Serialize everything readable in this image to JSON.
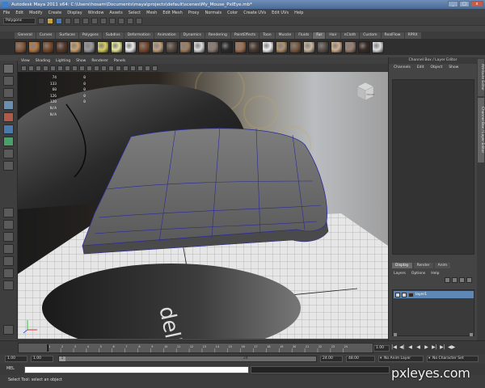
{
  "window": {
    "title": "Autodesk Maya 2011 x64: C:\\Users\\hosam\\Documents\\maya\\projects\\default\\scenes\\My_Mouse_PxlEye.mb*",
    "minimize": "_",
    "maximize": "□",
    "close": "x"
  },
  "menubar": [
    "File",
    "Edit",
    "Modify",
    "Create",
    "Display",
    "Window",
    "Assets",
    "Select",
    "Mesh",
    "Edit Mesh",
    "Proxy",
    "Normals",
    "Color",
    "Create UVs",
    "Edit UVs",
    "Help"
  ],
  "statusline": {
    "mode": "Polygons"
  },
  "shelf_tabs": [
    "General",
    "Curves",
    "Surfaces",
    "Polygons",
    "Subdivs",
    "Deformation",
    "Animation",
    "Dynamics",
    "Rendering",
    "PaintEffects",
    "Toon",
    "Muscle",
    "Fluids",
    "Fur",
    "Hair",
    "nCloth",
    "Custom",
    "RealFlow",
    "RPRX"
  ],
  "active_shelf": "Fur",
  "fur_swatches": [
    "#8a5a3a",
    "#b07a4a",
    "#7a4a2a",
    "#5a3a2a",
    "#caa070",
    "#9a9a9a",
    "#d8d060",
    "#e8e8a0",
    "#ececec",
    "#7a4a30",
    "#c0a080",
    "#5a4a40",
    "#a08060",
    "#dcdcdc",
    "#8a7a70",
    "#2a2a2a",
    "#a07050",
    "#4a3a30",
    "#f0f0f0",
    "#b09070",
    "#7a5a40",
    "#c8b8a0",
    "#5a5048",
    "#d0b090",
    "#9a8070",
    "#3a2a24",
    "#e0e0e0"
  ],
  "viewport_menu": [
    "View",
    "Shading",
    "Lighting",
    "Show",
    "Renderer",
    "Panels"
  ],
  "hud_stats": [
    {
      "a": "74",
      "b": "0"
    },
    {
      "a": "133",
      "b": "0"
    },
    {
      "a": "60",
      "b": "0"
    },
    {
      "a": "126",
      "b": "0"
    },
    {
      "a": "120",
      "b": "0"
    },
    {
      "a": "N/A",
      "b": ""
    },
    {
      "a": "N/A",
      "b": ""
    }
  ],
  "viewcube_label": "FRONT",
  "channel_box": {
    "title": "Channel Box / Layer Editor",
    "menu": [
      "Channels",
      "Edit",
      "Object",
      "Show"
    ]
  },
  "layer_editor": {
    "tabs": [
      "Display",
      "Render",
      "Anim"
    ],
    "active_tab": "Display",
    "menu": [
      "Layers",
      "Options",
      "Help"
    ],
    "layers": [
      {
        "v": "V",
        "p": "P",
        "name": "layer1"
      }
    ]
  },
  "side_tabs": [
    "Attribute Editor",
    "Channel Box / Layer Editor"
  ],
  "timeslider": {
    "ticks": [
      "1",
      "2",
      "3",
      "4",
      "5",
      "6",
      "7",
      "8",
      "9",
      "10",
      "11",
      "12",
      "13",
      "14",
      "15",
      "16",
      "17",
      "18",
      "19",
      "20",
      "21",
      "22",
      "23",
      "24"
    ],
    "current": "1.00",
    "playback": [
      "|◀",
      "◀|",
      "◀",
      "◀",
      "▶",
      "▶|",
      "▶|",
      "◀▶"
    ]
  },
  "range": {
    "start_a": "1.00",
    "start_b": "1.00",
    "handle_start": "1",
    "handle_end": "24",
    "end_a": "24.00",
    "end_b": "48.00",
    "anim_layer": "No Anim Layer",
    "char_set": "No Character Set"
  },
  "command": {
    "label": "MEL",
    "input": "",
    "output": ""
  },
  "help_line": "Select Tool: select an object",
  "watermark": "pxleyes.com"
}
